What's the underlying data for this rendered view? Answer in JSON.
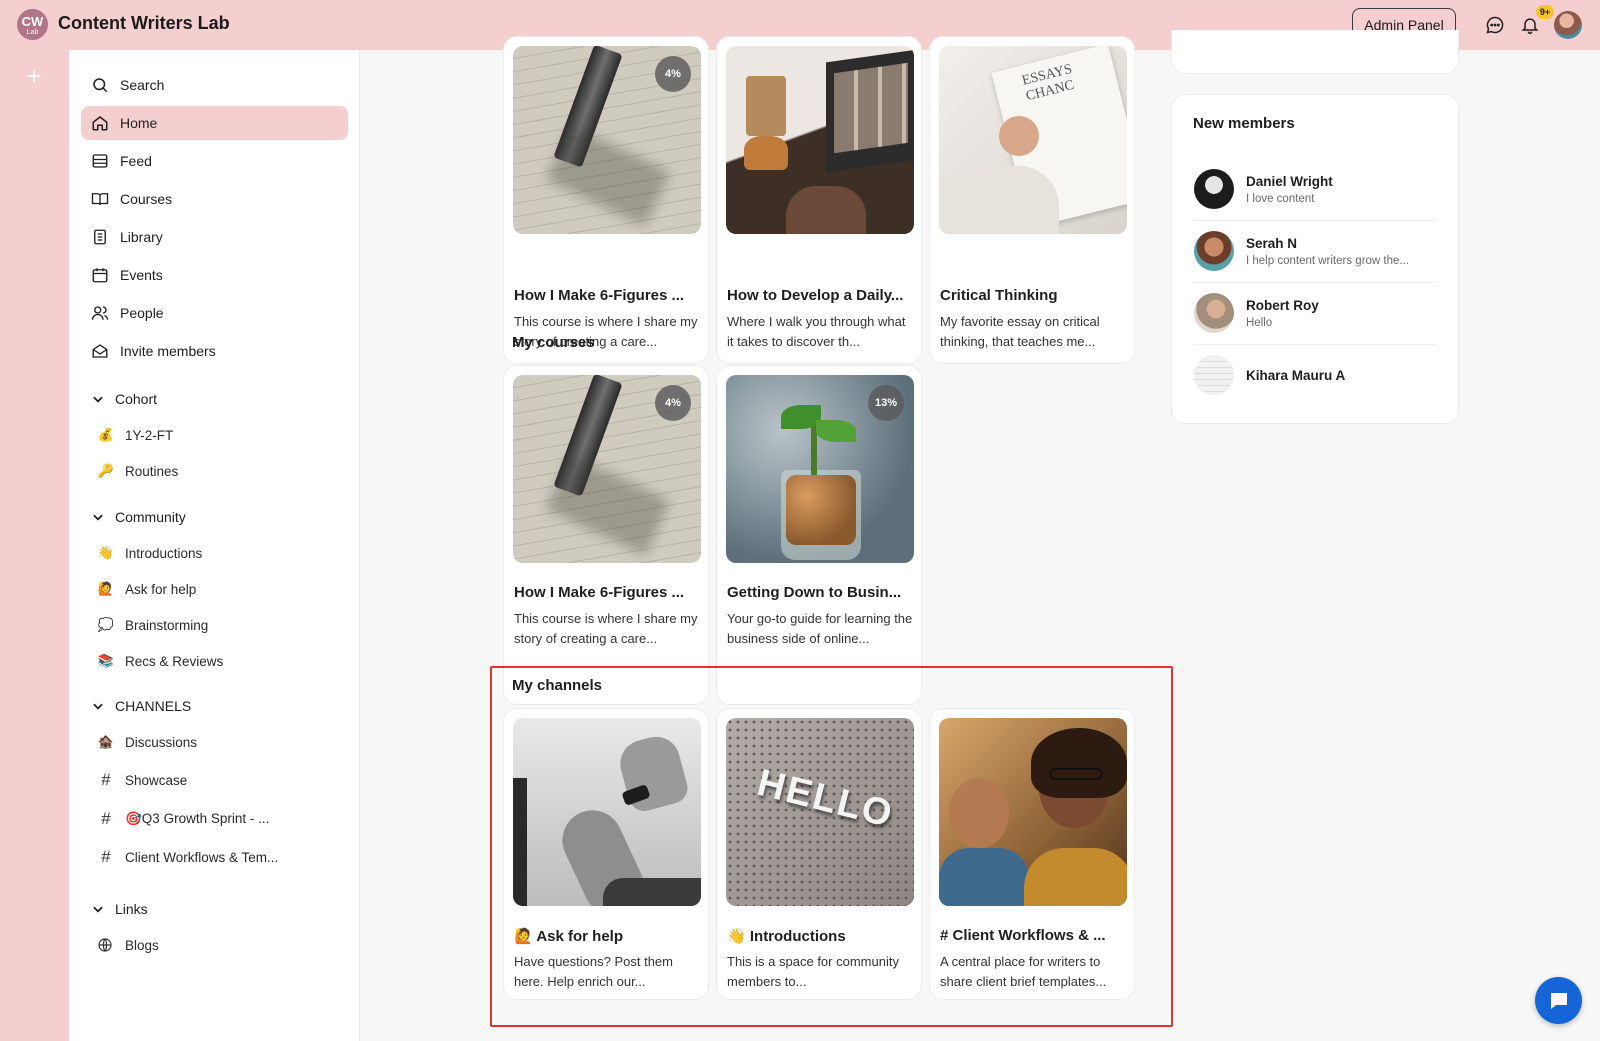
{
  "app": {
    "logo_text": "CW",
    "logo_sub": "Lab",
    "title": "Content Writers Lab",
    "admin_label": "Admin Panel",
    "notif_badge": "9+"
  },
  "nav": {
    "search": "Search",
    "home": "Home",
    "feed": "Feed",
    "courses": "Courses",
    "library": "Library",
    "events": "Events",
    "people": "People",
    "invite": "Invite members"
  },
  "sections": {
    "cohort": {
      "label": "Cohort",
      "items": [
        {
          "emoji": "💰",
          "label": "1Y-2-FT"
        },
        {
          "emoji": "🔑",
          "label": "Routines"
        }
      ]
    },
    "community": {
      "label": "Community",
      "items": [
        {
          "emoji": "👋",
          "label": "Introductions"
        },
        {
          "emoji": "🙋",
          "label": "Ask for help"
        },
        {
          "emoji": "💭",
          "label": "Brainstorming"
        },
        {
          "emoji": "📚",
          "label": "Recs & Reviews"
        }
      ]
    },
    "channels": {
      "label": "CHANNELS",
      "items": [
        {
          "icon": "house",
          "emoji": "🏚️",
          "label": "Discussions"
        },
        {
          "icon": "hash",
          "label": "Showcase"
        },
        {
          "icon": "hash",
          "label": "🎯Q3 Growth Sprint - ..."
        },
        {
          "icon": "hash",
          "label": "Client Workflows & Tem..."
        }
      ]
    },
    "links": {
      "label": "Links",
      "items": [
        {
          "icon": "globe",
          "label": "Blogs"
        }
      ]
    }
  },
  "main": {
    "top_cards": [
      {
        "title": "How I Make 6-Figures ...",
        "desc": "This course is where I share my story of creating a care...",
        "progress": "4%"
      },
      {
        "title": "How to Develop a Daily...",
        "desc": "Where I walk you through what it takes to discover th..."
      },
      {
        "title": "Critical Thinking",
        "desc": "My favorite essay on critical thinking, that teaches me..."
      }
    ],
    "my_courses": {
      "title": "My courses",
      "cards": [
        {
          "title": "How I Make 6-Figures ...",
          "desc": "This course is where I share my story of creating a care...",
          "progress": "4%"
        },
        {
          "title": "Getting Down to Busin...",
          "desc": "Your go-to guide for learning the business side of online...",
          "progress": "13%"
        }
      ]
    },
    "my_channels": {
      "title": "My channels",
      "cards": [
        {
          "emoji": "🙋",
          "title": "Ask for help",
          "desc": "Have questions? Post them here. Help enrich our..."
        },
        {
          "emoji": "👋",
          "title": "Introductions",
          "desc": "This is a space for community members to..."
        },
        {
          "emoji": "#",
          "title": "Client Workflows & ...",
          "desc": "A central place for writers to share client brief templates..."
        }
      ]
    }
  },
  "right": {
    "new_members": {
      "title": "New members",
      "members": [
        {
          "name": "Daniel Wright",
          "bio": "I love content"
        },
        {
          "name": "Serah N",
          "bio": "I help content writers grow the..."
        },
        {
          "name": "Robert Roy",
          "bio": "Hello"
        },
        {
          "name": "Kihara Mauru A",
          "bio": ""
        }
      ]
    }
  },
  "colors": {
    "brand_pink": "#f5cfd0",
    "highlight_red": "#e03434",
    "fab_blue": "#1565d8"
  }
}
